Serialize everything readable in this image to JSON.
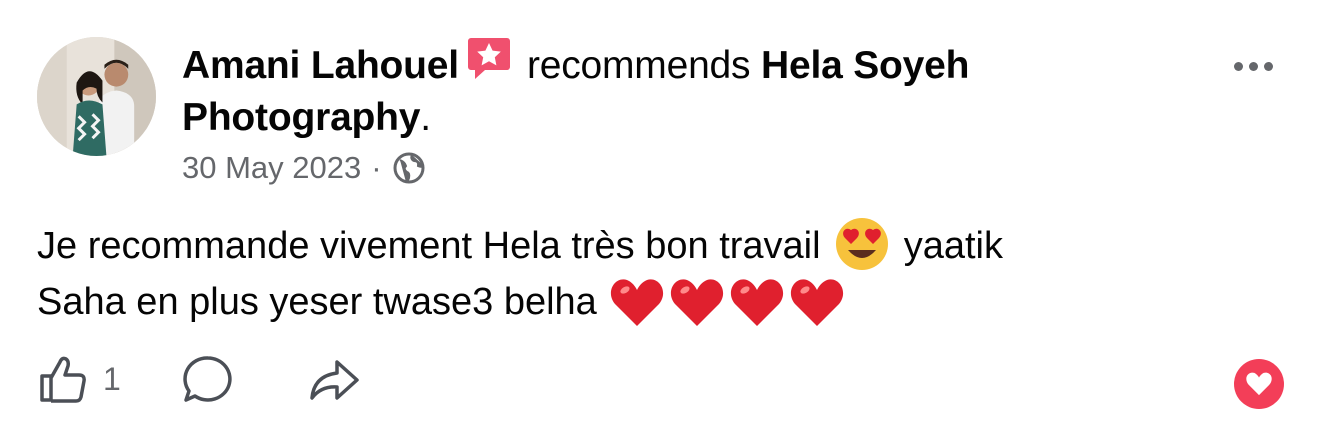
{
  "post": {
    "author": "Amani Lahouel",
    "verb": "recommends",
    "page_name": "Hela Soyeh Photography",
    "punctuation": ".",
    "date": "30 May 2023",
    "separator": "·",
    "audience_icon": "globe-icon",
    "text_line1": "Je recommande vivement Hela très bon travail",
    "text_after_emoji": "yaatik",
    "text_line2": "Saha en plus yeser twase3 belha",
    "emojis": [
      "smiling-face-with-heart-eyes",
      "red-heart",
      "red-heart",
      "red-heart",
      "red-heart"
    ]
  },
  "actions": {
    "like_count": "1",
    "like_icon": "thumbs-up-icon",
    "comment_icon": "comment-icon",
    "share_icon": "share-icon",
    "more_icon": "more-options-icon",
    "reaction_icon": "heart-reaction-icon"
  },
  "colors": {
    "text": "#050505",
    "secondary": "#65676b",
    "recommend_badge": "#f0506e",
    "reaction": "#f33e58",
    "heart": "#e0202e",
    "emoji_face": "#f7c23c"
  }
}
